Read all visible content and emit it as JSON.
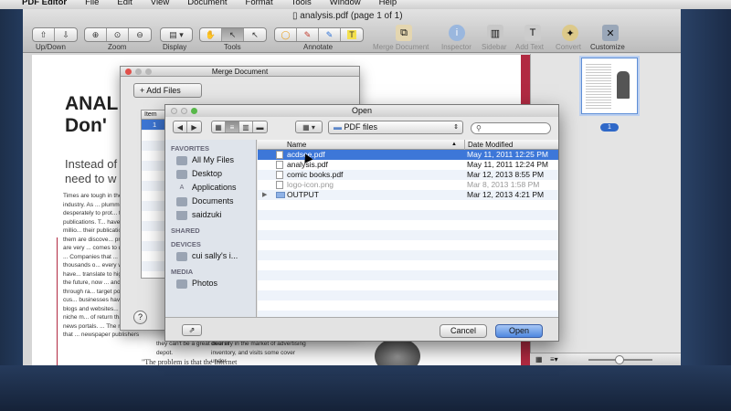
{
  "menubar": {
    "apple": "",
    "app": "PDF Editor",
    "items": [
      "File",
      "Edit",
      "View",
      "Document",
      "Format",
      "Tools",
      "Window",
      "Help"
    ]
  },
  "window": {
    "title": "analysis.pdf (page 1 of 1)"
  },
  "toolbar": {
    "updown": "Up/Down",
    "zoom": "Zoom",
    "display": "Display",
    "tools": "Tools",
    "annotate": "Annotate",
    "merge": "Merge Document",
    "inspector": "Inspector",
    "sidebar": "Sidebar",
    "addtext": "Add Text",
    "convert": "Convert",
    "customize": "Customize"
  },
  "article": {
    "heading1": "ANAL",
    "heading2": "Don'",
    "intro1": "Instead of",
    "intro2": "need to w",
    "col1": "Times are tough in the ... industry. As ... plummeted ... desperately to prot... their publications. T... have invested millio... their publications. T... of them are discove... print media are very ... comes to delivering ... Companies that ... spend thousands o... every week have... translate to higher ... in the future, now ... and click-through ra... target potential cus... businesses have dis... blogs and websites... content in niche m... of return than huge news portals. ... The result is that ... newspaper publishers",
    "col2": "they can't be a great deal in depot.",
    "col3": "diversify in the market of advertising inventory, and visits some cover under",
    "quote": "\"The problem is that the Internet"
  },
  "thumbnail": {
    "page": "1"
  },
  "merge_dialog": {
    "title": "Merge Document",
    "add_files": "Add Files",
    "col_item": "Item",
    "row1": "1",
    "help": "?"
  },
  "open_dialog": {
    "title": "Open",
    "path": "PDF files",
    "search_placeholder": "",
    "sidebar": {
      "favorites_head": "FAVORITES",
      "favorites": [
        "All My Files",
        "Desktop",
        "Applications",
        "Documents",
        "saidzuki"
      ],
      "shared_head": "SHARED",
      "devices_head": "DEVICES",
      "devices": [
        "cui sally's i..."
      ],
      "media_head": "MEDIA",
      "media": [
        "Photos"
      ]
    },
    "columns": {
      "name": "Name",
      "date": "Date Modified"
    },
    "files": [
      {
        "name": "acdsee.pdf",
        "date": "May 11, 2011 12:25 PM"
      },
      {
        "name": "analysis.pdf",
        "date": "May 11, 2011 12:24 PM"
      },
      {
        "name": "comic books.pdf",
        "date": "Mar 12, 2013 8:55 PM"
      },
      {
        "name": "logo-icon.png",
        "date": "Mar 8, 2013 1:58 PM"
      },
      {
        "name": "OUTPUT",
        "date": "Mar 12, 2013 4:21 PM"
      }
    ],
    "cancel": "Cancel",
    "open": "Open"
  }
}
